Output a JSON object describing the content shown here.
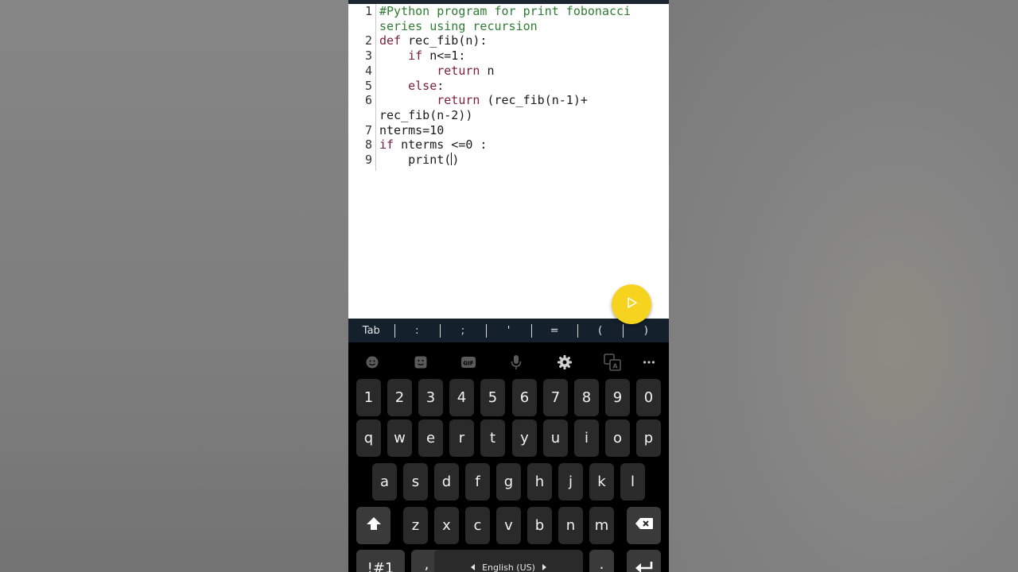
{
  "editor": {
    "lines": [
      {
        "num": "1",
        "segments": [
          {
            "t": "#Python program for print fobonacci",
            "c": "comment"
          }
        ]
      },
      {
        "num": "",
        "segments": [
          {
            "t": "series using recursion",
            "c": "comment"
          }
        ]
      },
      {
        "num": "2",
        "segments": [
          {
            "t": "def ",
            "c": "kw"
          },
          {
            "t": "rec_fib(n):",
            "c": "plain"
          }
        ]
      },
      {
        "num": "3",
        "segments": [
          {
            "t": "    if ",
            "c": "kw"
          },
          {
            "t": "n<=1:",
            "c": "plain"
          }
        ]
      },
      {
        "num": "4",
        "segments": [
          {
            "t": "        return ",
            "c": "kw"
          },
          {
            "t": "n",
            "c": "plain"
          }
        ]
      },
      {
        "num": "5",
        "segments": [
          {
            "t": "    else",
            "c": "kw"
          },
          {
            "t": ":",
            "c": "plain"
          }
        ]
      },
      {
        "num": "6",
        "segments": [
          {
            "t": "        return ",
            "c": "kw"
          },
          {
            "t": "(rec_fib(n-1)+",
            "c": "plain"
          }
        ]
      },
      {
        "num": "",
        "segments": [
          {
            "t": "rec_fib(n-2))",
            "c": "plain"
          }
        ]
      },
      {
        "num": "7",
        "segments": [
          {
            "t": "nterms=10",
            "c": "plain"
          }
        ]
      },
      {
        "num": "8",
        "segments": [
          {
            "t": "if ",
            "c": "kw"
          },
          {
            "t": "nterms <=0 :",
            "c": "plain"
          }
        ]
      },
      {
        "num": "9",
        "segments": [
          {
            "t": "    print(",
            "c": "plain"
          },
          {
            "t": "|cursor|",
            "c": "cursor"
          },
          {
            "t": ")",
            "c": "plain"
          }
        ]
      }
    ]
  },
  "run_button": {
    "icon": "play-icon",
    "color": "#f5d31f"
  },
  "symbol_bar": [
    "Tab",
    ":",
    ";",
    "'",
    "=",
    "(",
    ")"
  ],
  "keyboard_toolbar": [
    "emoji-icon",
    "sticker-icon",
    "gif-icon",
    "mic-icon",
    "settings-icon",
    "translate-icon",
    "more-icon"
  ],
  "keyboard": {
    "row_numbers": [
      "1",
      "2",
      "3",
      "4",
      "5",
      "6",
      "7",
      "8",
      "9",
      "0"
    ],
    "row_1": [
      "q",
      "w",
      "e",
      "r",
      "t",
      "y",
      "u",
      "i",
      "o",
      "p"
    ],
    "row_2": [
      "a",
      "s",
      "d",
      "f",
      "g",
      "h",
      "j",
      "k",
      "l"
    ],
    "row_3": [
      "z",
      "x",
      "c",
      "v",
      "b",
      "n",
      "m"
    ],
    "symbols_key": "!#1",
    "comma_key": ",",
    "period_key": ".",
    "space_label": "English (US)"
  },
  "colors": {
    "comment": "#2e7d32",
    "keyword": "#7b1e3a",
    "keyboard_bg": "#000000",
    "key_bg": "#2a2a2a",
    "symbol_bar_bg": "#14202c"
  }
}
